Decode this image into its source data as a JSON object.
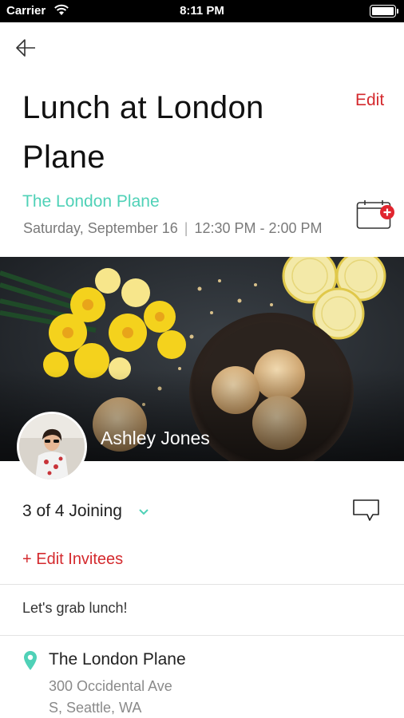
{
  "status_bar": {
    "carrier": "Carrier",
    "time": "8:11 PM"
  },
  "event": {
    "title": "Lunch at London Plane",
    "edit_label": "Edit",
    "venue": "The London Plane",
    "date": "Saturday, September 16",
    "separator": "|",
    "time": "12:30 PM - 2:00 PM"
  },
  "host": {
    "name": "Ashley Jones"
  },
  "attendance": {
    "joining_label": "3 of 4 Joining",
    "edit_invitees_label": "+ Edit Invitees"
  },
  "note": "Let's grab lunch!",
  "location": {
    "name": "The London Plane",
    "address_line1": "300 Occidental Ave",
    "address_line2": "S, Seattle, WA"
  },
  "colors": {
    "accent_teal": "#4fd1b7",
    "accent_red": "#d42a2e"
  }
}
